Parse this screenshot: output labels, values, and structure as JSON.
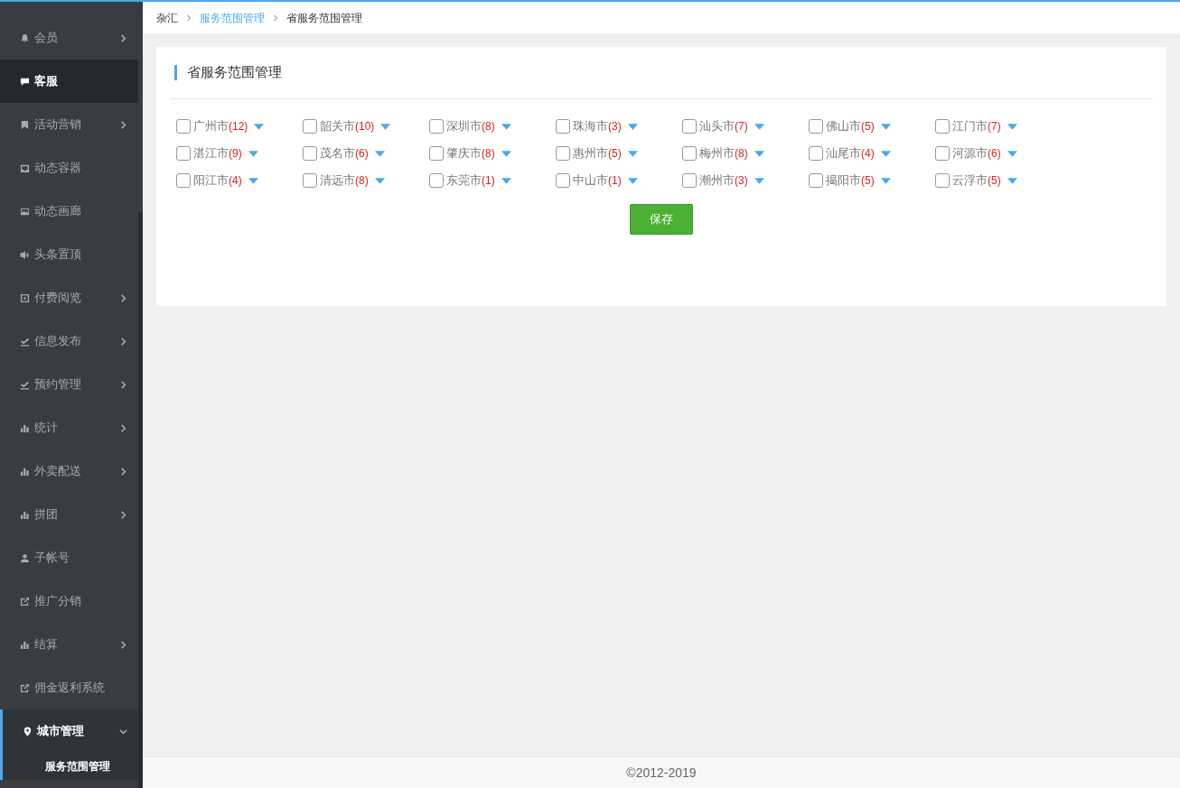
{
  "sidebar": {
    "items": [
      {
        "label": "会员",
        "selected": false,
        "has_submenu": true,
        "expanded": false
      },
      {
        "label": "客服",
        "selected": true,
        "has_submenu": false
      },
      {
        "label": "活动营销",
        "selected": false,
        "has_submenu": true,
        "expanded": false
      },
      {
        "label": "动态容器",
        "selected": false,
        "has_submenu": false
      },
      {
        "label": "动态画廊",
        "selected": false,
        "has_submenu": false
      },
      {
        "label": "头条置顶",
        "selected": false,
        "has_submenu": false
      },
      {
        "label": "付费阅览",
        "selected": false,
        "has_submenu": true,
        "expanded": false
      },
      {
        "label": "信息发布",
        "selected": false,
        "has_submenu": true,
        "expanded": false
      },
      {
        "label": "预约管理",
        "selected": false,
        "has_submenu": true,
        "expanded": false
      },
      {
        "label": "统计",
        "selected": false,
        "has_submenu": true,
        "expanded": false
      },
      {
        "label": "外卖配送",
        "selected": false,
        "has_submenu": true,
        "expanded": false
      },
      {
        "label": "拼团",
        "selected": false,
        "has_submenu": true,
        "expanded": false
      },
      {
        "label": "子帐号",
        "selected": false,
        "has_submenu": false
      },
      {
        "label": "推广分销",
        "selected": false,
        "has_submenu": false
      },
      {
        "label": "结算",
        "selected": false,
        "has_submenu": true,
        "expanded": false
      },
      {
        "label": "佣金返利系统",
        "selected": false,
        "has_submenu": false
      },
      {
        "label": "城市管理",
        "selected": false,
        "has_submenu": true,
        "expanded": true,
        "children": [
          {
            "label": "服务范围管理",
            "selected": true
          }
        ]
      }
    ]
  },
  "breadcrumb": [
    {
      "label": "杂汇",
      "link": false
    },
    {
      "label": "服务范围管理",
      "link": true
    },
    {
      "label": "省服务范围管理",
      "link": false
    }
  ],
  "panel": {
    "title": "省服务范围管理",
    "cities": [
      {
        "name": "广州市",
        "count": "(12)",
        "checked": false
      },
      {
        "name": "韶关市",
        "count": "(10)",
        "checked": false
      },
      {
        "name": "深圳市",
        "count": "(8)",
        "checked": false
      },
      {
        "name": "珠海市",
        "count": "(3)",
        "checked": false
      },
      {
        "name": "汕头市",
        "count": "(7)",
        "checked": false
      },
      {
        "name": "佛山市",
        "count": "(5)",
        "checked": false
      },
      {
        "name": "江门市",
        "count": "(7)",
        "checked": false
      },
      {
        "name": "湛江市",
        "count": "(9)",
        "checked": false
      },
      {
        "name": "茂名市",
        "count": "(6)",
        "checked": false
      },
      {
        "name": "肇庆市",
        "count": "(8)",
        "checked": false
      },
      {
        "name": "惠州市",
        "count": "(5)",
        "checked": false
      },
      {
        "name": "梅州市",
        "count": "(8)",
        "checked": false
      },
      {
        "name": "汕尾市",
        "count": "(4)",
        "checked": false
      },
      {
        "name": "河源市",
        "count": "(6)",
        "checked": false
      },
      {
        "name": "阳江市",
        "count": "(4)",
        "checked": false
      },
      {
        "name": "清远市",
        "count": "(8)",
        "checked": false
      },
      {
        "name": "东莞市",
        "count": "(1)",
        "checked": false
      },
      {
        "name": "中山市",
        "count": "(1)",
        "checked": false
      },
      {
        "name": "潮州市",
        "count": "(3)",
        "checked": false
      },
      {
        "name": "揭阳市",
        "count": "(5)",
        "checked": false
      },
      {
        "name": "云浮市",
        "count": "(5)",
        "checked": false
      }
    ],
    "save_button": "保存"
  },
  "footer": "©2012-2019"
}
